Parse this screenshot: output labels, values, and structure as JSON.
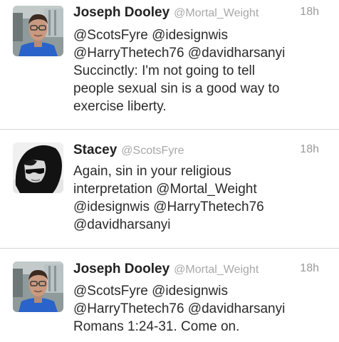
{
  "tweets": [
    {
      "avatar": "avatar-man-glasses",
      "name": "Joseph Dooley",
      "handle": "@Mortal_Weight",
      "time": "18h",
      "text": "@ScotsFyre @idesignwis\n@HarryThetech76 @davidharsanyi\nSuccinctly: I'm not going to tell\npeople sexual sin is a good way to\nexercise liberty."
    },
    {
      "avatar": "avatar-woman-sunglasses",
      "name": "Stacey",
      "handle": "@ScotsFyre",
      "time": "18h",
      "text": "Again, sin in your religious\ninterpretation @Mortal_Weight\n@idesignwis @HarryThetech76\n@davidharsanyi"
    },
    {
      "avatar": "avatar-man-glasses",
      "name": "Joseph Dooley",
      "handle": "@Mortal_Weight",
      "time": "18h",
      "text": "@ScotsFyre @idesignwis\n@HarryThetech76 @davidharsanyi\nRomans 1:24-31. Come on."
    }
  ],
  "colors": {
    "divider": "#d6d6d6",
    "handle": "#a8a8a8",
    "time": "#9a9a9a",
    "name": "#222222",
    "text": "#2b2b2b"
  }
}
